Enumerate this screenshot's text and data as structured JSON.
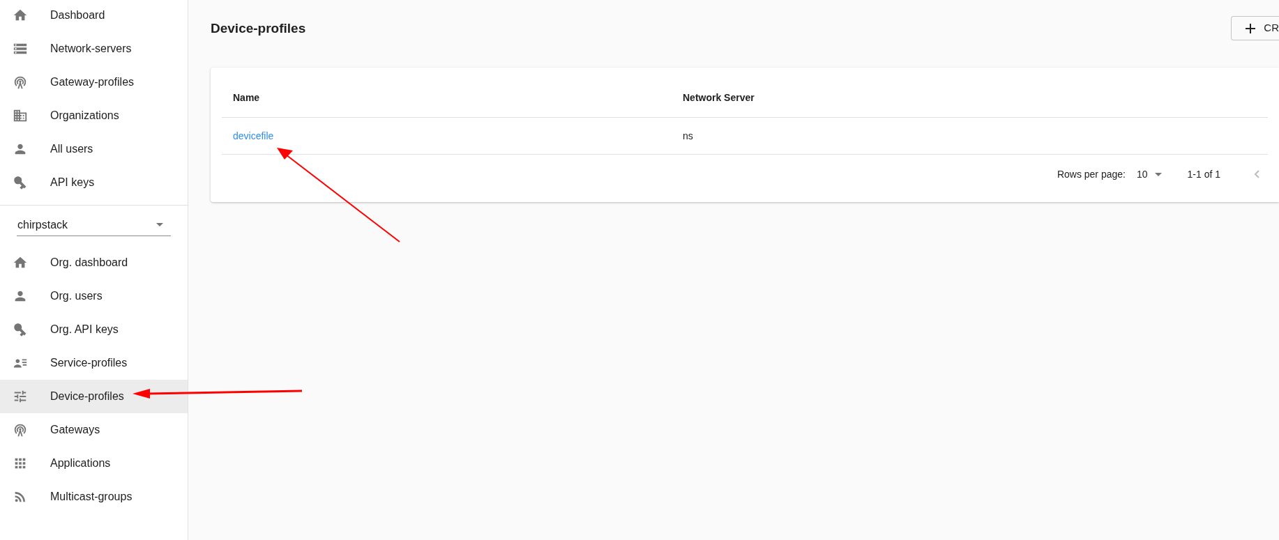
{
  "sidebar": {
    "admin_items": [
      {
        "label": "Dashboard",
        "selected": false
      },
      {
        "label": "Network-servers",
        "selected": false
      },
      {
        "label": "Gateway-profiles",
        "selected": false
      },
      {
        "label": "Organizations",
        "selected": false
      },
      {
        "label": "All users",
        "selected": false
      },
      {
        "label": "API keys",
        "selected": false
      }
    ],
    "organization_select": {
      "value": "chirpstack"
    },
    "org_items": [
      {
        "label": "Org. dashboard",
        "selected": false
      },
      {
        "label": "Org. users",
        "selected": false
      },
      {
        "label": "Org. API keys",
        "selected": false
      },
      {
        "label": "Service-profiles",
        "selected": false
      },
      {
        "label": "Device-profiles",
        "selected": true
      },
      {
        "label": "Gateways",
        "selected": false
      },
      {
        "label": "Applications",
        "selected": false
      },
      {
        "label": "Multicast-groups",
        "selected": false
      }
    ]
  },
  "page": {
    "title": "Device-profiles",
    "create_button": "CR"
  },
  "table": {
    "columns": [
      "Name",
      "Network Server"
    ],
    "rows": [
      {
        "name": "devicefile",
        "network_server": "ns"
      }
    ],
    "pagination": {
      "rows_per_page_label": "Rows per page:",
      "rows_per_page": "10",
      "range": "1-1 of 1"
    }
  }
}
